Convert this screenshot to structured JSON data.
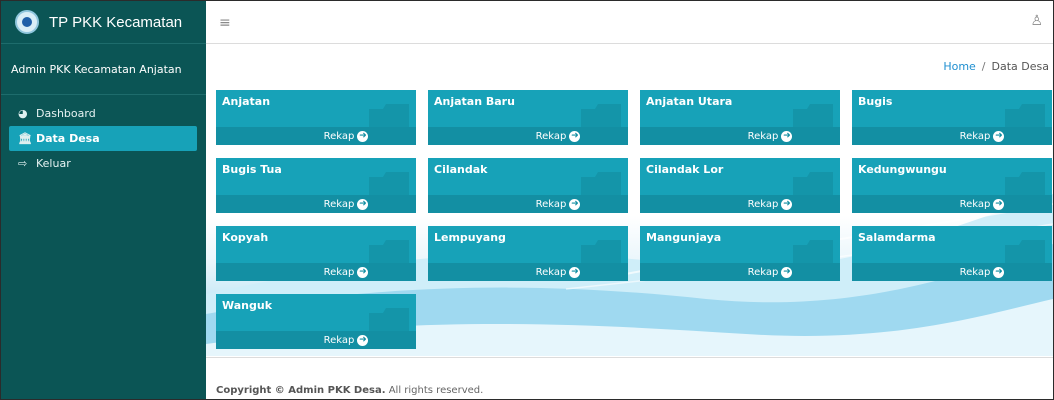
{
  "sidebar": {
    "brand": "TP PKK Kecamatan",
    "user": "Admin PKK Kecamatan Anjatan",
    "items": [
      {
        "label": "Dashboard",
        "icon": "dashboard-icon"
      },
      {
        "label": "Data Desa",
        "icon": "landmark-icon"
      },
      {
        "label": "Keluar",
        "icon": "sign-out-icon"
      }
    ]
  },
  "topbar": {
    "menu_icon": "hamburger-icon",
    "user_icon": "user-icon"
  },
  "breadcrumb": {
    "home": "Home",
    "separator": "/",
    "current": "Data Desa"
  },
  "cards": [
    {
      "name": "Anjatan",
      "link": "Rekap"
    },
    {
      "name": "Anjatan Baru",
      "link": "Rekap"
    },
    {
      "name": "Anjatan Utara",
      "link": "Rekap"
    },
    {
      "name": "Bugis",
      "link": "Rekap"
    },
    {
      "name": "Bugis Tua",
      "link": "Rekap"
    },
    {
      "name": "Cilandak",
      "link": "Rekap"
    },
    {
      "name": "Cilandak Lor",
      "link": "Rekap"
    },
    {
      "name": "Kedungwungu",
      "link": "Rekap"
    },
    {
      "name": "Kopyah",
      "link": "Rekap"
    },
    {
      "name": "Lempuyang",
      "link": "Rekap"
    },
    {
      "name": "Mangunjaya",
      "link": "Rekap"
    },
    {
      "name": "Salamdarma",
      "link": "Rekap"
    },
    {
      "name": "Wanguk",
      "link": "Rekap"
    }
  ],
  "footer": {
    "copyright_prefix": "Copyright ©",
    "owner": "Admin PKK Desa.",
    "suffix": "All rights reserved."
  },
  "colors": {
    "sidebar": "#0b5555",
    "accent": "#17a2b8",
    "card_footer": "#138fa3"
  }
}
